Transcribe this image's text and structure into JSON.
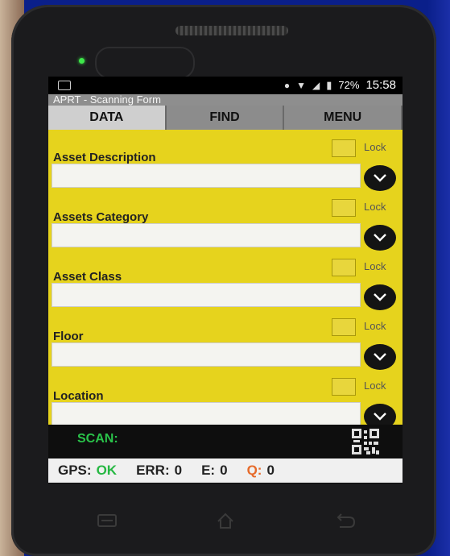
{
  "status_bar": {
    "battery_percent": "72%",
    "time": "15:58"
  },
  "app": {
    "title": "APRT - Scanning Form"
  },
  "tabs": [
    {
      "label": "DATA",
      "active": true
    },
    {
      "label": "FIND",
      "active": false
    },
    {
      "label": "MENU",
      "active": false
    }
  ],
  "fields": [
    {
      "label": "Asset Description",
      "lock_label": "Lock",
      "value": ""
    },
    {
      "label": "Assets Category",
      "lock_label": "Lock",
      "value": ""
    },
    {
      "label": "Asset Class",
      "lock_label": "Lock",
      "value": ""
    },
    {
      "label": "Floor",
      "lock_label": "Lock",
      "value": ""
    },
    {
      "label": "Location",
      "lock_label": "Lock",
      "value": ""
    }
  ],
  "scan": {
    "label": "SCAN:"
  },
  "gps_bar": {
    "gps_label": "GPS:",
    "gps_value": "OK",
    "err_label": "ERR:",
    "err_value": "0",
    "e_label": "E:",
    "e_value": "0",
    "q_label": "Q:",
    "q_value": "0"
  },
  "colors": {
    "form_background": "#e6d31d",
    "ok_green": "#26b843",
    "q_orange": "#e66a2a",
    "scan_green": "#2ac34a"
  }
}
